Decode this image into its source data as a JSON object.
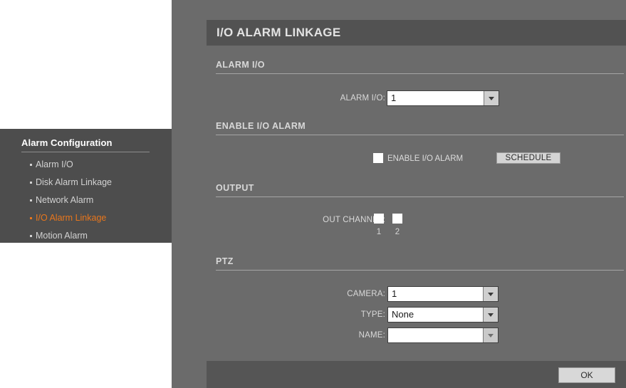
{
  "sidebar": {
    "title": "Alarm Configuration",
    "items": [
      {
        "label": "Alarm I/O",
        "active": false
      },
      {
        "label": "Disk Alarm Linkage",
        "active": false
      },
      {
        "label": "Network Alarm",
        "active": false
      },
      {
        "label": "I/O Alarm Linkage",
        "active": true
      },
      {
        "label": "Motion Alarm",
        "active": false
      }
    ],
    "active_color": "#e8761c"
  },
  "page": {
    "title": "I/O ALARM LINKAGE"
  },
  "sections": {
    "alarm_io": {
      "header": "ALARM I/O",
      "field_label": "ALARM I/O:",
      "value": "1"
    },
    "enable_io_alarm": {
      "header": "ENABLE I/O ALARM",
      "checkbox_label": "ENABLE I/O ALARM",
      "checked": false,
      "schedule_button": "SCHEDULE"
    },
    "output": {
      "header": "OUTPUT",
      "field_label": "OUT CHANNEL:",
      "channels": [
        {
          "number": "1",
          "checked": false
        },
        {
          "number": "2",
          "checked": false
        }
      ]
    },
    "ptz": {
      "header": "PTZ",
      "camera_label": "CAMERA:",
      "camera_value": "1",
      "type_label": "TYPE:",
      "type_value": "None",
      "name_label": "NAME:",
      "name_value": ""
    }
  },
  "footer": {
    "ok_label": "OK"
  }
}
